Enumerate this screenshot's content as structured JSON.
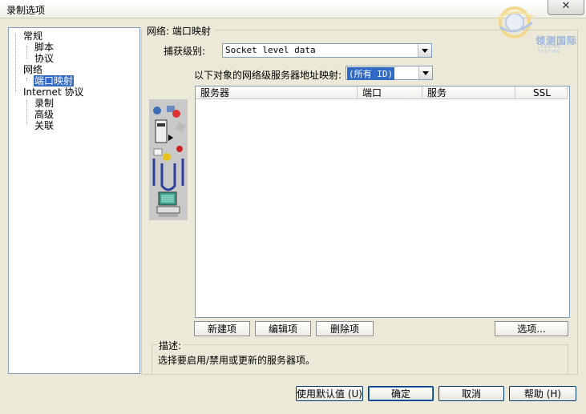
{
  "window": {
    "title": "录制选项",
    "close_glyph": "✕"
  },
  "watermark": {
    "text": "领测国际",
    "sub": "LEADING TESTING"
  },
  "tree": {
    "items": [
      {
        "label": "常规"
      },
      {
        "label": "脚本"
      },
      {
        "label": "协议"
      },
      {
        "label": "网络"
      },
      {
        "label": "端口映射",
        "selected": true
      },
      {
        "label": "Internet 协议"
      },
      {
        "label": "录制"
      },
      {
        "label": "高级"
      },
      {
        "label": "关联"
      }
    ]
  },
  "panel": {
    "title": "网络: 端口映射",
    "capture_label": "捕获级别:",
    "capture_value": "Socket level data",
    "map_label": "以下对象的网络级服务器地址映射:",
    "map_value": "(所有 ID)"
  },
  "listview": {
    "columns": [
      "服务器",
      "端口",
      "服务",
      "SSL"
    ]
  },
  "buttons": {
    "new_entry": "新建项",
    "edit_entry": "编辑项",
    "delete_entry": "删除项",
    "options": "选项..."
  },
  "description": {
    "label": "描述:",
    "text": "选择要启用/禁用或更新的服务器项。"
  },
  "footer": {
    "use_defaults": "使用默认值 (U)",
    "ok": "确定",
    "cancel": "取消",
    "help": "帮助 (H)"
  },
  "icons": [
    "network-diagram-icon",
    "computer-icon"
  ]
}
